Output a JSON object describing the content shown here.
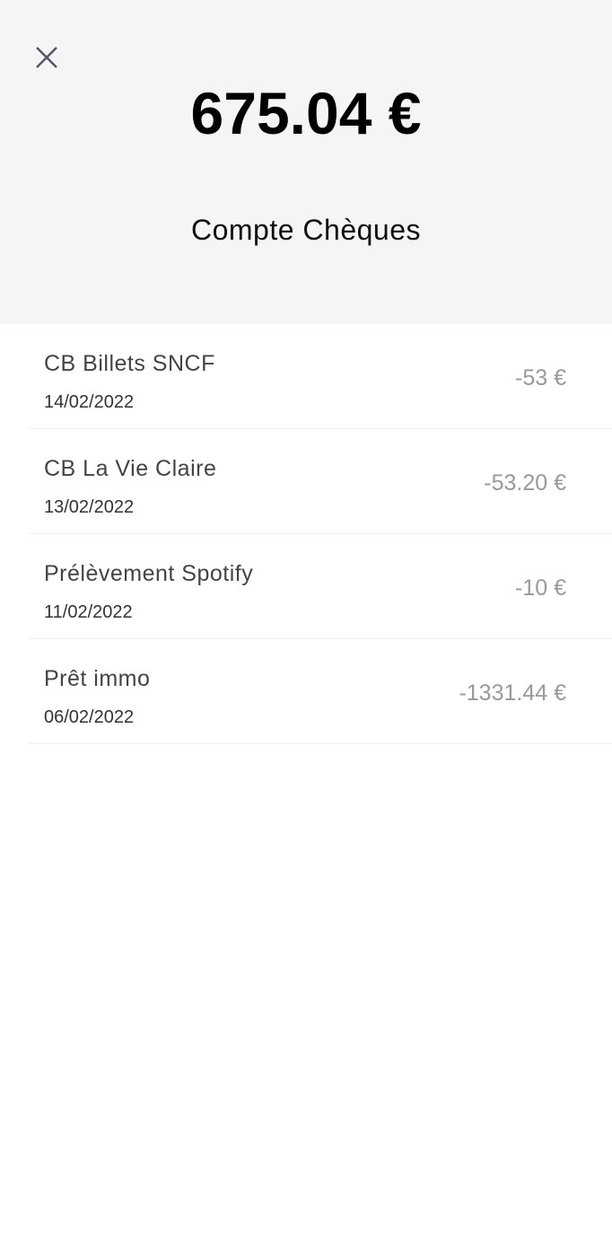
{
  "header": {
    "balance": "675.04 €",
    "account_name": "Compte Chèques",
    "close_icon": "close-icon"
  },
  "transactions": [
    {
      "label": "CB Billets SNCF",
      "date": "14/02/2022",
      "amount": "-53 €"
    },
    {
      "label": "CB La Vie Claire",
      "date": "13/02/2022",
      "amount": "-53.20 €"
    },
    {
      "label": "Prélèvement Spotify",
      "date": "11/02/2022",
      "amount": "-10 €"
    },
    {
      "label": "Prêt immo",
      "date": "06/02/2022",
      "amount": "-1331.44 €"
    }
  ]
}
